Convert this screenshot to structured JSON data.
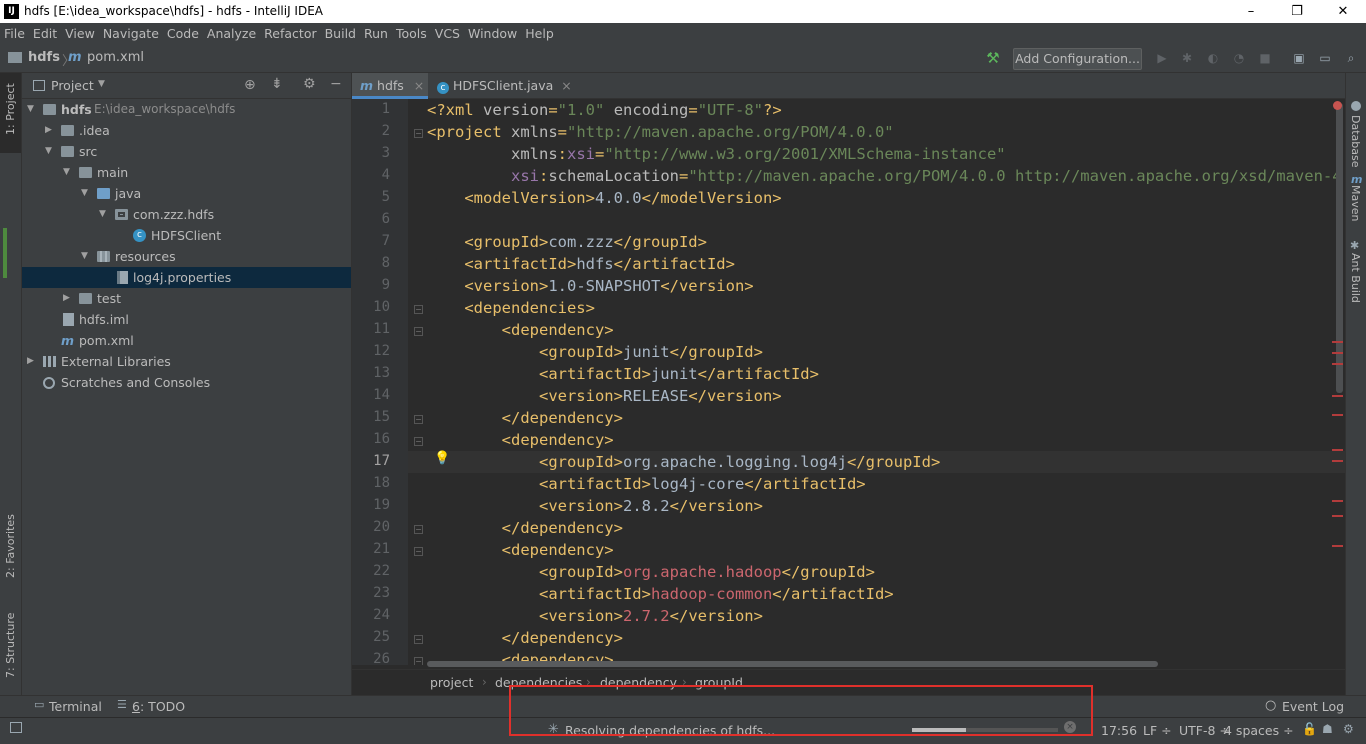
{
  "window": {
    "title": "hdfs [E:\\idea_workspace\\hdfs] - hdfs - IntelliJ IDEA",
    "logo": "IJ",
    "controls": {
      "minimize": "–",
      "restore": "❐",
      "close": "✕"
    }
  },
  "menu": [
    "File",
    "Edit",
    "View",
    "Navigate",
    "Code",
    "Analyze",
    "Refactor",
    "Build",
    "Run",
    "Tools",
    "VCS",
    "Window",
    "Help"
  ],
  "navbar": {
    "crumb_project": "hdfs",
    "crumb_sep": "〉",
    "crumb_file_icon": "m",
    "crumb_file": "pom.xml",
    "add_configuration": "Add Configuration..."
  },
  "left_strip": {
    "project": "1: Project",
    "favorites": "2: Favorites",
    "structure": "7: Structure"
  },
  "right_strip": {
    "database": "Database",
    "maven": "Maven",
    "ant": "Ant Build"
  },
  "project_panel": {
    "title": "Project",
    "tree": [
      {
        "label": "hdfs",
        "extra": "E:\\idea_workspace\\hdfs",
        "bold": true,
        "arrow": "▼",
        "icon": "folder"
      },
      {
        "label": ".idea",
        "arrow": "▶",
        "icon": "folder"
      },
      {
        "label": "src",
        "arrow": "▼",
        "icon": "folder"
      },
      {
        "label": "main",
        "arrow": "▼",
        "icon": "folder"
      },
      {
        "label": "java",
        "arrow": "▼",
        "icon": "folder-blue"
      },
      {
        "label": "com.zzz.hdfs",
        "arrow": "▼",
        "icon": "package"
      },
      {
        "label": "HDFSClient",
        "arrow": "",
        "icon": "class"
      },
      {
        "label": "resources",
        "arrow": "▼",
        "icon": "folder-res"
      },
      {
        "label": "log4j.properties",
        "arrow": "",
        "icon": "properties"
      },
      {
        "label": "test",
        "arrow": "▶",
        "icon": "folder"
      },
      {
        "label": "hdfs.iml",
        "arrow": "",
        "icon": "iml"
      },
      {
        "label": "pom.xml",
        "arrow": "",
        "icon": "maven"
      },
      {
        "label": "External Libraries",
        "arrow": "▶",
        "icon": "libraries"
      },
      {
        "label": "Scratches and Consoles",
        "arrow": "",
        "icon": "scratches"
      }
    ]
  },
  "editor": {
    "tabs": [
      {
        "icon": "m",
        "label": "hdfs"
      },
      {
        "icon": "c",
        "label": "HDFSClient.java"
      }
    ],
    "tab_close": "×",
    "line_numbers": [
      "1",
      "2",
      "3",
      "4",
      "5",
      "6",
      "7",
      "8",
      "9",
      "10",
      "11",
      "12",
      "13",
      "14",
      "15",
      "16",
      "17",
      "18",
      "19",
      "20",
      "21",
      "22",
      "23",
      "24",
      "25",
      "26"
    ],
    "lines": [
      [
        [
          "t",
          "<?xml "
        ],
        [
          "a",
          "version"
        ],
        [
          "t",
          "="
        ],
        [
          "s",
          "\"1.0\""
        ],
        [
          "t",
          " "
        ],
        [
          "a",
          "encoding"
        ],
        [
          "t",
          "="
        ],
        [
          "s",
          "\"UTF-8\""
        ],
        [
          "t",
          "?>"
        ]
      ],
      [
        [
          "t",
          "<project "
        ],
        [
          "a",
          "xmlns"
        ],
        [
          "t",
          "="
        ],
        [
          "s",
          "\"http://maven.apache.org/POM/4.0.0\""
        ]
      ],
      [
        [
          "p",
          "         "
        ],
        [
          "a",
          "xmlns"
        ],
        [
          "t",
          ":"
        ],
        [
          "n",
          "xsi"
        ],
        [
          "t",
          "="
        ],
        [
          "s",
          "\"http://www.w3.org/2001/XMLSchema-instance\""
        ]
      ],
      [
        [
          "p",
          "         "
        ],
        [
          "n",
          "xsi"
        ],
        [
          "t",
          ":"
        ],
        [
          "a",
          "schemaLocation"
        ],
        [
          "t",
          "="
        ],
        [
          "s",
          "\"http://maven.apache.org/POM/4.0.0 http://maven.apache.org/xsd/maven-4.0.0.xsd\""
        ]
      ],
      [
        [
          "p",
          "    "
        ],
        [
          "t",
          "<modelVersion>"
        ],
        [
          "p",
          "4.0.0"
        ],
        [
          "t",
          "</modelVersion>"
        ]
      ],
      [],
      [
        [
          "p",
          "    "
        ],
        [
          "t",
          "<groupId>"
        ],
        [
          "p",
          "com.zzz"
        ],
        [
          "t",
          "</groupId>"
        ]
      ],
      [
        [
          "p",
          "    "
        ],
        [
          "t",
          "<artifactId>"
        ],
        [
          "p",
          "hdfs"
        ],
        [
          "t",
          "</artifactId>"
        ]
      ],
      [
        [
          "p",
          "    "
        ],
        [
          "t",
          "<version>"
        ],
        [
          "p",
          "1.0-SNAPSHOT"
        ],
        [
          "t",
          "</version>"
        ]
      ],
      [
        [
          "p",
          "    "
        ],
        [
          "t",
          "<dependencies>"
        ]
      ],
      [
        [
          "p",
          "        "
        ],
        [
          "t",
          "<dependency>"
        ]
      ],
      [
        [
          "p",
          "            "
        ],
        [
          "t",
          "<groupId>"
        ],
        [
          "p",
          "junit"
        ],
        [
          "t",
          "</groupId>"
        ]
      ],
      [
        [
          "p",
          "            "
        ],
        [
          "t",
          "<artifactId>"
        ],
        [
          "p",
          "junit"
        ],
        [
          "t",
          "</artifactId>"
        ]
      ],
      [
        [
          "p",
          "            "
        ],
        [
          "t",
          "<version>"
        ],
        [
          "p",
          "RELEASE"
        ],
        [
          "t",
          "</version>"
        ]
      ],
      [
        [
          "p",
          "        "
        ],
        [
          "t",
          "</dependency>"
        ]
      ],
      [
        [
          "p",
          "        "
        ],
        [
          "t",
          "<dependency>"
        ]
      ],
      [
        [
          "p",
          "            "
        ],
        [
          "t",
          "<groupId>"
        ],
        [
          "p",
          "org.apache.logging.log4j"
        ],
        [
          "t",
          "</groupId>"
        ]
      ],
      [
        [
          "p",
          "            "
        ],
        [
          "t",
          "<artifactId>"
        ],
        [
          "p",
          "log4j-core"
        ],
        [
          "t",
          "</artifactId>"
        ]
      ],
      [
        [
          "p",
          "            "
        ],
        [
          "t",
          "<version>"
        ],
        [
          "p",
          "2.8.2"
        ],
        [
          "t",
          "</version>"
        ]
      ],
      [
        [
          "p",
          "        "
        ],
        [
          "t",
          "</dependency>"
        ]
      ],
      [
        [
          "p",
          "        "
        ],
        [
          "t",
          "<dependency>"
        ]
      ],
      [
        [
          "p",
          "            "
        ],
        [
          "t",
          "<groupId>"
        ],
        [
          "r",
          "org.apache.hadoop"
        ],
        [
          "t",
          "</groupId>"
        ]
      ],
      [
        [
          "p",
          "            "
        ],
        [
          "t",
          "<artifactId>"
        ],
        [
          "r",
          "hadoop-common"
        ],
        [
          "t",
          "</artifactId>"
        ]
      ],
      [
        [
          "p",
          "            "
        ],
        [
          "t",
          "<version>"
        ],
        [
          "r",
          "2.7.2"
        ],
        [
          "t",
          "</version>"
        ]
      ],
      [
        [
          "p",
          "        "
        ],
        [
          "t",
          "</dependency>"
        ]
      ],
      [
        [
          "p",
          "        "
        ],
        [
          "t",
          "<dependency>"
        ]
      ]
    ],
    "current_line": 17,
    "breadcrumbs": [
      "project",
      "dependencies",
      "dependency",
      "groupId"
    ],
    "breadcrumb_sep": "›"
  },
  "bottom_tabs": {
    "terminal": "Terminal",
    "todo_key": "6",
    "todo_label": ": TODO",
    "event_log": "Event Log"
  },
  "status": {
    "task": "Resolving dependencies of hdfs...",
    "progress": 0.37,
    "cursor": "17:56",
    "line_sep": "LF ÷",
    "encoding": "UTF-8 ÷",
    "indent": "4 spaces ÷"
  },
  "colors": {
    "highlight_box": "#e0302b",
    "accent": "#4a88c7"
  }
}
